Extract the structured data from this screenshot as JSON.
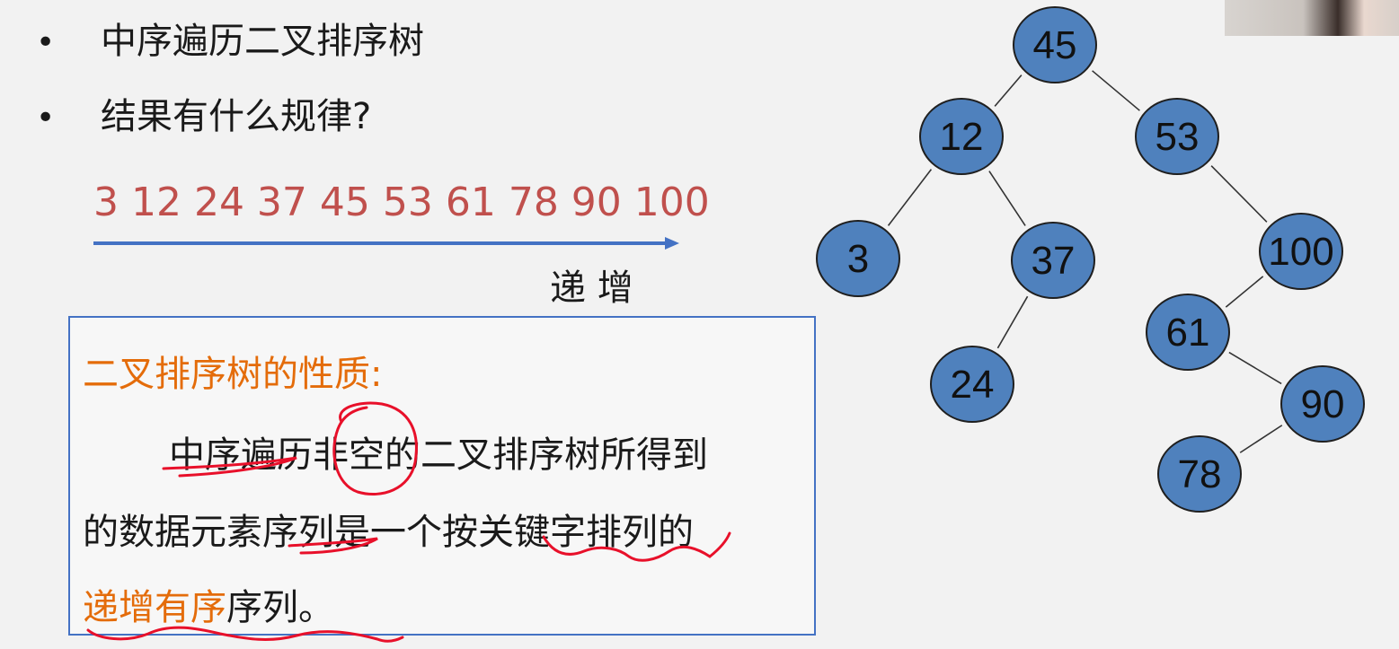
{
  "bullets": [
    "中序遍历二叉排序树",
    "结果有什么规律?"
  ],
  "bullet_symbol": "•",
  "sequence": "3 12 24 37 45 53 61 78 90 100",
  "increase_label": "递 增",
  "property": {
    "title": "二叉排序树的性质:",
    "line1": "中序遍历非空的二叉排序树所得到",
    "line2": "的数据元素序列是一个按关键字排列的",
    "line3_highlight": "递增有序",
    "line3_rest": "序列。"
  },
  "tree": {
    "nodes": [
      "45",
      "12",
      "53",
      "3",
      "37",
      "100",
      "24",
      "61",
      "90",
      "78"
    ],
    "edges": [
      [
        "45",
        "12"
      ],
      [
        "45",
        "53"
      ],
      [
        "12",
        "3"
      ],
      [
        "12",
        "37"
      ],
      [
        "53",
        "100"
      ],
      [
        "37",
        "24"
      ],
      [
        "100",
        "61"
      ],
      [
        "61",
        "90"
      ],
      [
        "90",
        "78"
      ]
    ],
    "node_fill": "#4f81bd",
    "edge_color": "#333333"
  },
  "colors": {
    "sequence": "#c0504d",
    "highlight": "#e46c0a",
    "annotation": "#e8102a",
    "arrow": "#4472c4",
    "box_border": "#4472c4"
  }
}
